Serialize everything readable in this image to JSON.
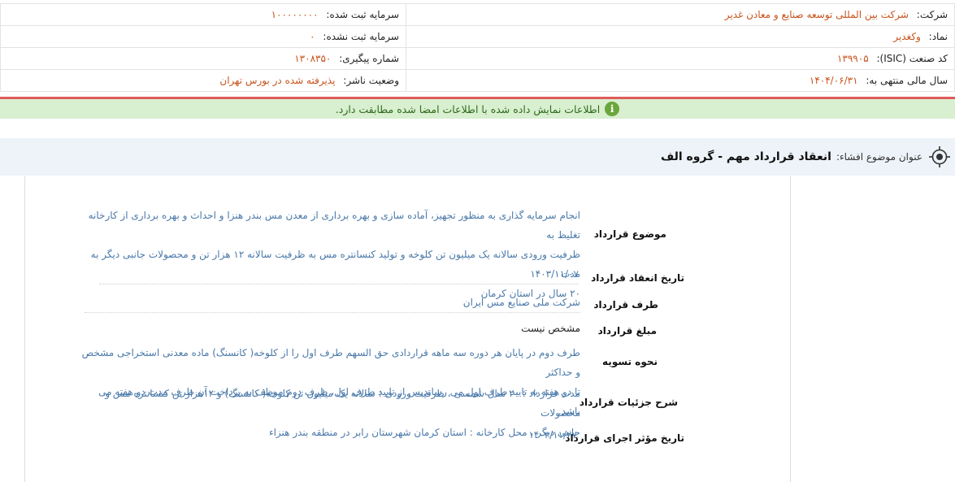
{
  "info": {
    "company_label": "شرکت:",
    "company_value": "شرکت بین المللی توسعه صنایع و معادن غدیر",
    "capital_registered_label": "سرمایه ثبت شده:",
    "capital_registered_value": "۱۰۰۰۰۰۰۰۰",
    "symbol_label": "نماد:",
    "symbol_value": "وکغدیر",
    "capital_unregistered_label": "سرمایه ثبت نشده:",
    "capital_unregistered_value": "۰",
    "isic_label": "کد صنعت (ISIC):",
    "isic_value": "۱۳۹۹۰۵",
    "tracking_label": "شماره پیگیری:",
    "tracking_value": "۱۳۰۸۳۵۰",
    "fiscal_label": "سال مالی منتهی به:",
    "fiscal_value": "۱۴۰۴/۰۶/۳۱",
    "publisher_status_label": "وضعیت ناشر:",
    "publisher_status_value": "پذیرفته شده در بورس تهران"
  },
  "notice": {
    "icon": "i",
    "text": "اطلاعات نمایش داده شده با اطلاعات امضا شده مطابقت دارد."
  },
  "subject": {
    "label": "عنوان موضوع افشاء:",
    "title": "انعقاد قرارداد مهم - گروه الف"
  },
  "details": {
    "subject_label": "موضوع قرارداد",
    "subject_line1": "انجام سرمایه گذاری به منظور تجهیز، آماده سازی و بهره برداری از معدن مس بندر هنزا و احداث و بهره برداری از کارخانه تغلیظ به",
    "subject_line2": "ظرفیت ورودی سالانه یک میلیون تن کلوخه و تولید کنسانتره مس به ظرفیت سالانه ۱۲ هزار تن و محصولات جانبی دیگر به مدت",
    "subject_line3": "۲۰ سال در استان کرمان",
    "date_label": "تاریخ انعقاد قرارداد",
    "date_value": "۱۴۰۳/۱۱/۰۷",
    "party_label": "طرف قرارداد",
    "party_value": "شرکت ملی صنایع مس ایران",
    "amount_label": "مبلغ قرارداد",
    "amount_value": "مشخص نیست",
    "settlement_label": "نحوه تسویه",
    "settlement_line1": "طرف دوم در پایان هر دوره سه ماهه قراردادی حق السهم طرف اول را از کلوخه( کانسنگ) ماده معدنی استخراجی مشخص و حداکثر",
    "settlement_line2": "تا دو هفته به تایید طرف اول می رساندپس از تایید طرف اول، طرف دوم موظف به پرداخت آن ظرف مدت دو هفته می باشد.",
    "description_label": "شرح جزئیات قرارداد",
    "description_line1": "مدت قرارداد : ۲۰ سال شمسی ، ظرفیت ورودی : سالانه یک میلیون تن کلوخه( کانسنگ) و ۱۲هزار تن کنسانتره مس و محصولات",
    "description_line2": "جانبی دیگر ، محل کارخانه : استان کرمان شهرستان رابر در منطقه بندر هنزاء",
    "effective_label": "تاریخ مؤثر اجرای قرارداد",
    "effective_value": "۱۴۰۳/۱۱/۲۷"
  },
  "colors": {
    "value_orange": "#c8531b",
    "value_blue": "#4a79a9",
    "notice_bg": "#d8efd0",
    "separator_red": "#e05a5a"
  }
}
